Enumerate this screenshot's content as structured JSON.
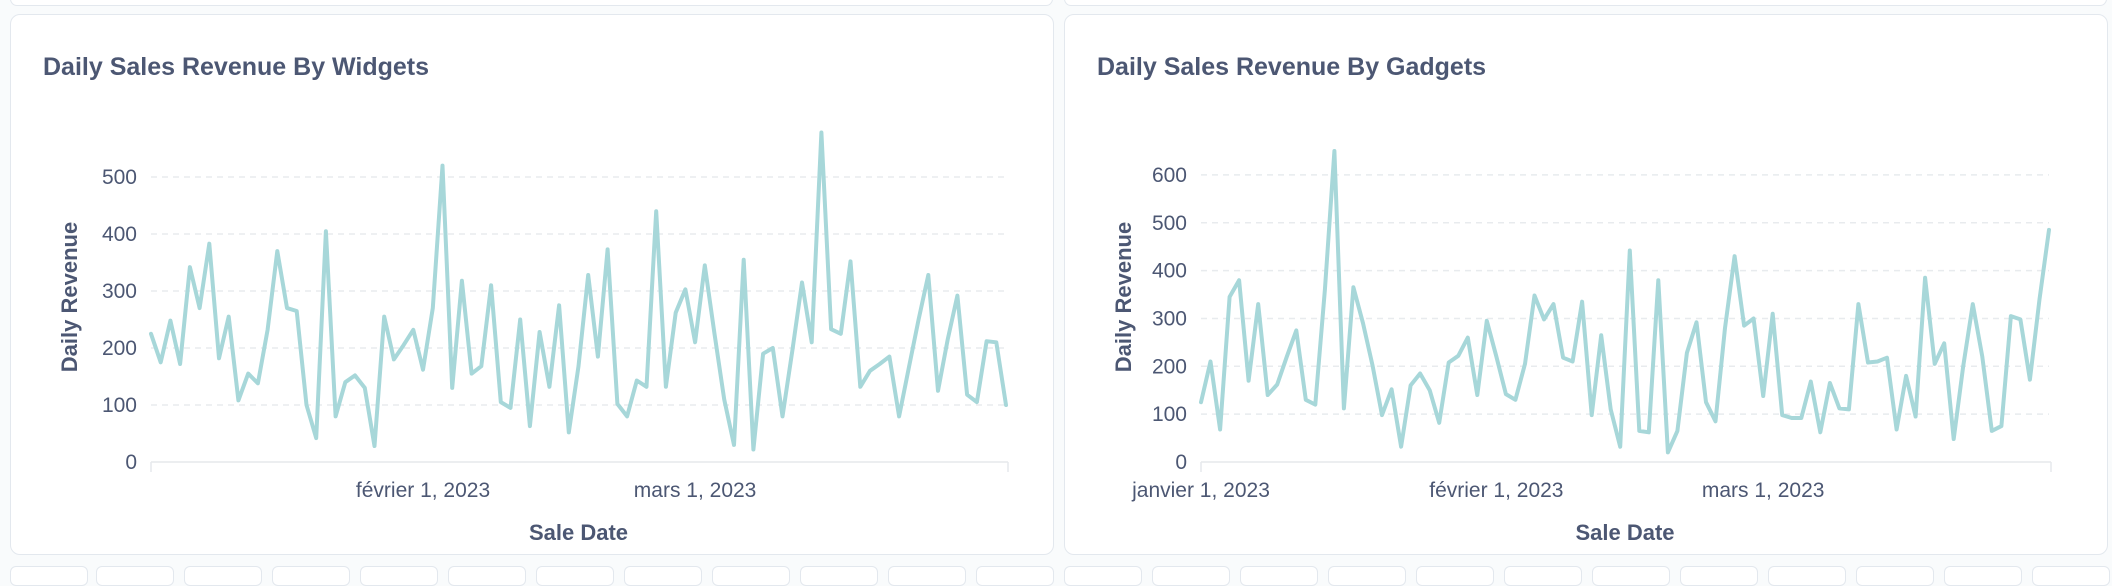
{
  "charts": [
    {
      "title": "Daily Sales Revenue By Widgets",
      "chart_data": {
        "type": "line",
        "title": "Daily Sales Revenue By Widgets",
        "xlabel": "Sale Date",
        "ylabel": "Daily Revenue",
        "x_start": "2023-01-04",
        "ylim": [
          0,
          540
        ],
        "yticks": [
          0,
          100,
          200,
          300,
          400,
          500
        ],
        "xtick_labels": [
          "février 1, 2023",
          "mars 1, 2023"
        ],
        "grid": true,
        "legend": "none",
        "color": "#a7d7d9",
        "values": [
          225,
          175,
          248,
          172,
          342,
          270,
          383,
          182,
          255,
          108,
          155,
          138,
          232,
          370,
          270,
          265,
          100,
          42,
          405,
          80,
          140,
          152,
          130,
          28,
          255,
          180,
          205,
          232,
          162,
          270,
          520,
          130,
          318,
          155,
          168,
          310,
          105,
          95,
          250,
          63,
          228,
          132,
          275,
          52,
          168,
          328,
          185,
          373,
          102,
          80,
          143,
          132,
          440,
          132,
          262,
          303,
          210,
          345,
          225,
          110,
          30,
          355,
          22,
          190,
          200,
          80,
          195,
          315,
          210,
          578,
          233,
          225,
          352,
          132,
          160,
          172,
          185,
          80,
          165,
          250,
          328,
          125,
          215,
          292,
          118,
          105,
          212,
          210,
          100
        ]
      }
    },
    {
      "title": "Daily Sales Revenue By Gadgets",
      "chart_data": {
        "type": "line",
        "title": "Daily Sales Revenue By Gadgets",
        "xlabel": "Sale Date",
        "ylabel": "Daily Revenue",
        "x_start": "2023-01-01",
        "ylim": [
          0,
          650
        ],
        "yticks": [
          0,
          100,
          200,
          300,
          400,
          500,
          600
        ],
        "xtick_labels": [
          "janvier 1, 2023",
          "février 1, 2023",
          "mars 1, 2023"
        ],
        "grid": true,
        "legend": "none",
        "color": "#a7d7d9",
        "values": [
          125,
          210,
          68,
          345,
          380,
          170,
          330,
          140,
          162,
          220,
          275,
          130,
          120,
          360,
          650,
          112,
          365,
          290,
          202,
          98,
          152,
          32,
          160,
          185,
          150,
          82,
          208,
          222,
          260,
          140,
          295,
          220,
          142,
          130,
          205,
          348,
          298,
          330,
          218,
          210,
          335,
          98,
          265,
          110,
          32,
          442,
          65,
          62,
          380,
          20,
          65,
          228,
          292,
          125,
          85,
          280,
          430,
          285,
          300,
          138,
          310,
          98,
          92,
          92,
          168,
          62,
          165,
          112,
          110,
          330,
          208,
          210,
          218,
          68,
          180,
          95,
          385,
          205,
          248,
          48,
          200,
          330,
          220,
          65,
          75,
          305,
          298,
          172,
          340,
          485
        ]
      }
    }
  ]
}
